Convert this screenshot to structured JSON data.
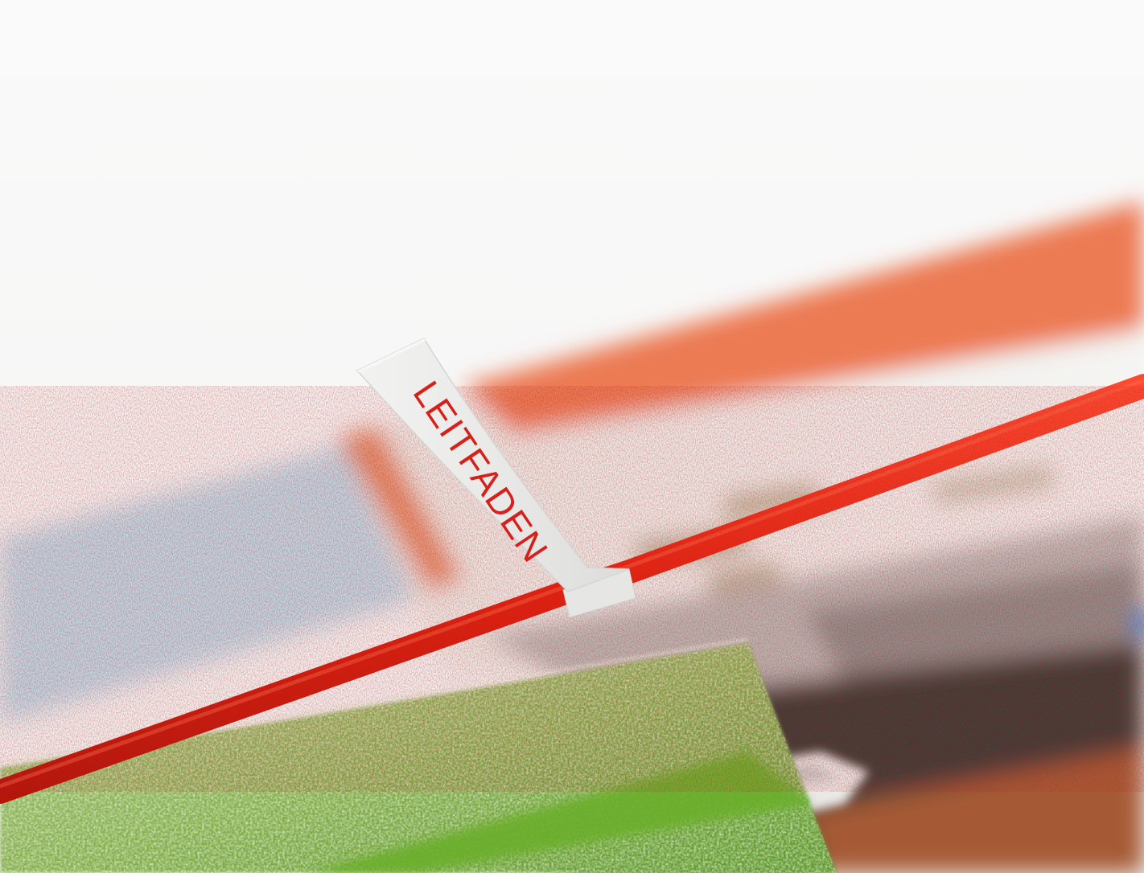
{
  "photo": {
    "tag_text": "LEITFADEN"
  },
  "colors": {
    "background": "#fbfbfb",
    "roof_orange": "#ec7a52",
    "sky_blue": "#bcd7e4",
    "grass_green": "#7aa640",
    "wall_white": "#f1f1ee",
    "road_dark": "#3b3a37",
    "cord_red": "#e62414",
    "tag_white": "#ededec",
    "tag_text_red": "#d8201a"
  }
}
